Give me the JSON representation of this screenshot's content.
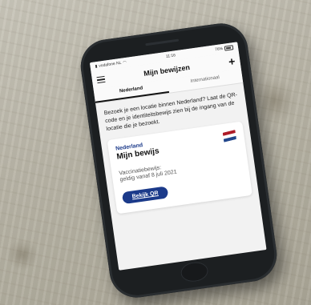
{
  "status_bar": {
    "carrier": "vodafone NL",
    "time": "11:16",
    "battery": "76%"
  },
  "header": {
    "title": "Mijn bewijzen",
    "add_label": "+"
  },
  "tabs": [
    {
      "label": "Nederland",
      "active": true
    },
    {
      "label": "Internationaal",
      "active": false
    }
  ],
  "intro_text": "Bezoek je een locatie binnen Nederland? Laat de QR-code en je identiteitsbewijs zien bij de ingang van de locatie die je bezoekt.",
  "card": {
    "country": "Nederland",
    "title": "Mijn bewijs",
    "proof_type": "Vaccinatiebewijs:",
    "valid_from": "geldig vanaf 8 juli 2021",
    "qr_button_label": "Bekijk QR",
    "flag_colors": [
      "#ae1c28",
      "#ffffff",
      "#21468b"
    ]
  },
  "colors": {
    "accent": "#1b3a8a",
    "phone_body": "#1c1f21",
    "screen_bg": "#f2f2f2"
  }
}
